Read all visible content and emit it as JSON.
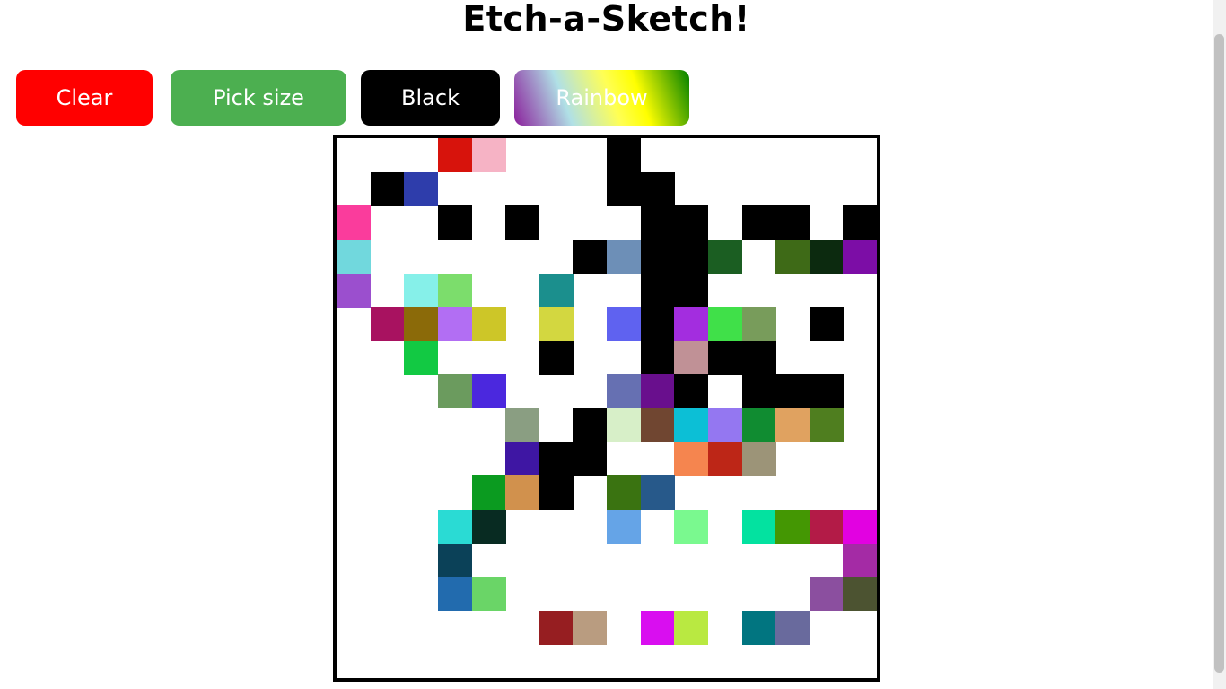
{
  "header": {
    "title": "Etch-a-Sketch!"
  },
  "toolbar": {
    "clear_label": "Clear",
    "pick_size_label": "Pick size",
    "black_label": "Black",
    "rainbow_label": "Rainbow"
  },
  "colors": {
    "clear_button": "#ff0000",
    "pick_size_button": "#4caf50",
    "black_button": "#000000",
    "grid_border": "#000000"
  },
  "grid": {
    "columns": 16,
    "rows": 16,
    "painted_cells": [
      {
        "r": 0,
        "c": 3,
        "color": "#d7130c"
      },
      {
        "r": 0,
        "c": 4,
        "color": "#f6b3c5"
      },
      {
        "r": 0,
        "c": 8,
        "color": "#000000"
      },
      {
        "r": 1,
        "c": 1,
        "color": "#000000"
      },
      {
        "r": 1,
        "c": 2,
        "color": "#2e3dab"
      },
      {
        "r": 1,
        "c": 8,
        "color": "#000000"
      },
      {
        "r": 1,
        "c": 9,
        "color": "#000000"
      },
      {
        "r": 2,
        "c": 0,
        "color": "#fa3c9c"
      },
      {
        "r": 2,
        "c": 3,
        "color": "#000000"
      },
      {
        "r": 2,
        "c": 5,
        "color": "#000000"
      },
      {
        "r": 2,
        "c": 9,
        "color": "#000000"
      },
      {
        "r": 2,
        "c": 10,
        "color": "#000000"
      },
      {
        "r": 2,
        "c": 12,
        "color": "#000000"
      },
      {
        "r": 2,
        "c": 13,
        "color": "#000000"
      },
      {
        "r": 2,
        "c": 15,
        "color": "#000000"
      },
      {
        "r": 3,
        "c": 0,
        "color": "#71d8dd"
      },
      {
        "r": 3,
        "c": 7,
        "color": "#000000"
      },
      {
        "r": 3,
        "c": 8,
        "color": "#6d8fb7"
      },
      {
        "r": 3,
        "c": 9,
        "color": "#000000"
      },
      {
        "r": 3,
        "c": 10,
        "color": "#000000"
      },
      {
        "r": 3,
        "c": 11,
        "color": "#1b5e22"
      },
      {
        "r": 3,
        "c": 13,
        "color": "#3e6a17"
      },
      {
        "r": 3,
        "c": 14,
        "color": "#0c2a0f"
      },
      {
        "r": 3,
        "c": 15,
        "color": "#7c0da6"
      },
      {
        "r": 4,
        "c": 0,
        "color": "#9b4fce"
      },
      {
        "r": 4,
        "c": 2,
        "color": "#86f0e9"
      },
      {
        "r": 4,
        "c": 3,
        "color": "#7cdd6c"
      },
      {
        "r": 4,
        "c": 6,
        "color": "#1b8f8d"
      },
      {
        "r": 4,
        "c": 9,
        "color": "#000000"
      },
      {
        "r": 4,
        "c": 10,
        "color": "#000000"
      },
      {
        "r": 5,
        "c": 1,
        "color": "#a81260"
      },
      {
        "r": 5,
        "c": 2,
        "color": "#8b6a09"
      },
      {
        "r": 5,
        "c": 3,
        "color": "#b26ef3"
      },
      {
        "r": 5,
        "c": 4,
        "color": "#cdc628"
      },
      {
        "r": 5,
        "c": 6,
        "color": "#d3d740"
      },
      {
        "r": 5,
        "c": 8,
        "color": "#5f62f0"
      },
      {
        "r": 5,
        "c": 9,
        "color": "#000000"
      },
      {
        "r": 5,
        "c": 10,
        "color": "#a32ddf"
      },
      {
        "r": 5,
        "c": 11,
        "color": "#40e049"
      },
      {
        "r": 5,
        "c": 12,
        "color": "#789c5b"
      },
      {
        "r": 5,
        "c": 14,
        "color": "#000000"
      },
      {
        "r": 6,
        "c": 2,
        "color": "#12c943"
      },
      {
        "r": 6,
        "c": 6,
        "color": "#000000"
      },
      {
        "r": 6,
        "c": 9,
        "color": "#000000"
      },
      {
        "r": 6,
        "c": 10,
        "color": "#c09196"
      },
      {
        "r": 6,
        "c": 11,
        "color": "#000000"
      },
      {
        "r": 6,
        "c": 12,
        "color": "#000000"
      },
      {
        "r": 7,
        "c": 3,
        "color": "#6b9b5e"
      },
      {
        "r": 7,
        "c": 4,
        "color": "#4b28de"
      },
      {
        "r": 7,
        "c": 8,
        "color": "#6670b2"
      },
      {
        "r": 7,
        "c": 9,
        "color": "#690f8d"
      },
      {
        "r": 7,
        "c": 10,
        "color": "#000000"
      },
      {
        "r": 7,
        "c": 12,
        "color": "#000000"
      },
      {
        "r": 7,
        "c": 13,
        "color": "#000000"
      },
      {
        "r": 7,
        "c": 14,
        "color": "#000000"
      },
      {
        "r": 8,
        "c": 5,
        "color": "#8a9e82"
      },
      {
        "r": 8,
        "c": 7,
        "color": "#000000"
      },
      {
        "r": 8,
        "c": 8,
        "color": "#d7efc8"
      },
      {
        "r": 8,
        "c": 9,
        "color": "#704631"
      },
      {
        "r": 8,
        "c": 10,
        "color": "#0cbfd6"
      },
      {
        "r": 8,
        "c": 11,
        "color": "#9477f1"
      },
      {
        "r": 8,
        "c": 12,
        "color": "#108c31"
      },
      {
        "r": 8,
        "c": 13,
        "color": "#e0a260"
      },
      {
        "r": 8,
        "c": 14,
        "color": "#4f7e1f"
      },
      {
        "r": 9,
        "c": 5,
        "color": "#3e16a3"
      },
      {
        "r": 9,
        "c": 6,
        "color": "#000000"
      },
      {
        "r": 9,
        "c": 7,
        "color": "#000000"
      },
      {
        "r": 9,
        "c": 10,
        "color": "#f5854f"
      },
      {
        "r": 9,
        "c": 11,
        "color": "#bd2617"
      },
      {
        "r": 9,
        "c": 12,
        "color": "#9c9478"
      },
      {
        "r": 10,
        "c": 4,
        "color": "#0b9b20"
      },
      {
        "r": 10,
        "c": 5,
        "color": "#d1914d"
      },
      {
        "r": 10,
        "c": 6,
        "color": "#000000"
      },
      {
        "r": 10,
        "c": 8,
        "color": "#3a7311"
      },
      {
        "r": 10,
        "c": 9,
        "color": "#27598a"
      },
      {
        "r": 11,
        "c": 3,
        "color": "#2adbd4"
      },
      {
        "r": 11,
        "c": 4,
        "color": "#082b22"
      },
      {
        "r": 11,
        "c": 8,
        "color": "#65a4e7"
      },
      {
        "r": 11,
        "c": 10,
        "color": "#7af98f"
      },
      {
        "r": 11,
        "c": 12,
        "color": "#03e2a0"
      },
      {
        "r": 11,
        "c": 13,
        "color": "#449703"
      },
      {
        "r": 11,
        "c": 14,
        "color": "#b31b47"
      },
      {
        "r": 11,
        "c": 15,
        "color": "#e201e1"
      },
      {
        "r": 12,
        "c": 3,
        "color": "#0b4158"
      },
      {
        "r": 12,
        "c": 15,
        "color": "#a42ba5"
      },
      {
        "r": 13,
        "c": 3,
        "color": "#226bae"
      },
      {
        "r": 13,
        "c": 4,
        "color": "#6ad567"
      },
      {
        "r": 13,
        "c": 14,
        "color": "#8b4f9f"
      },
      {
        "r": 13,
        "c": 15,
        "color": "#4c5331"
      },
      {
        "r": 14,
        "c": 6,
        "color": "#961e21"
      },
      {
        "r": 14,
        "c": 7,
        "color": "#b99c80"
      },
      {
        "r": 14,
        "c": 9,
        "color": "#d90ef0"
      },
      {
        "r": 14,
        "c": 10,
        "color": "#b9e941"
      },
      {
        "r": 14,
        "c": 12,
        "color": "#017580"
      },
      {
        "r": 14,
        "c": 13,
        "color": "#696a9d"
      }
    ]
  }
}
